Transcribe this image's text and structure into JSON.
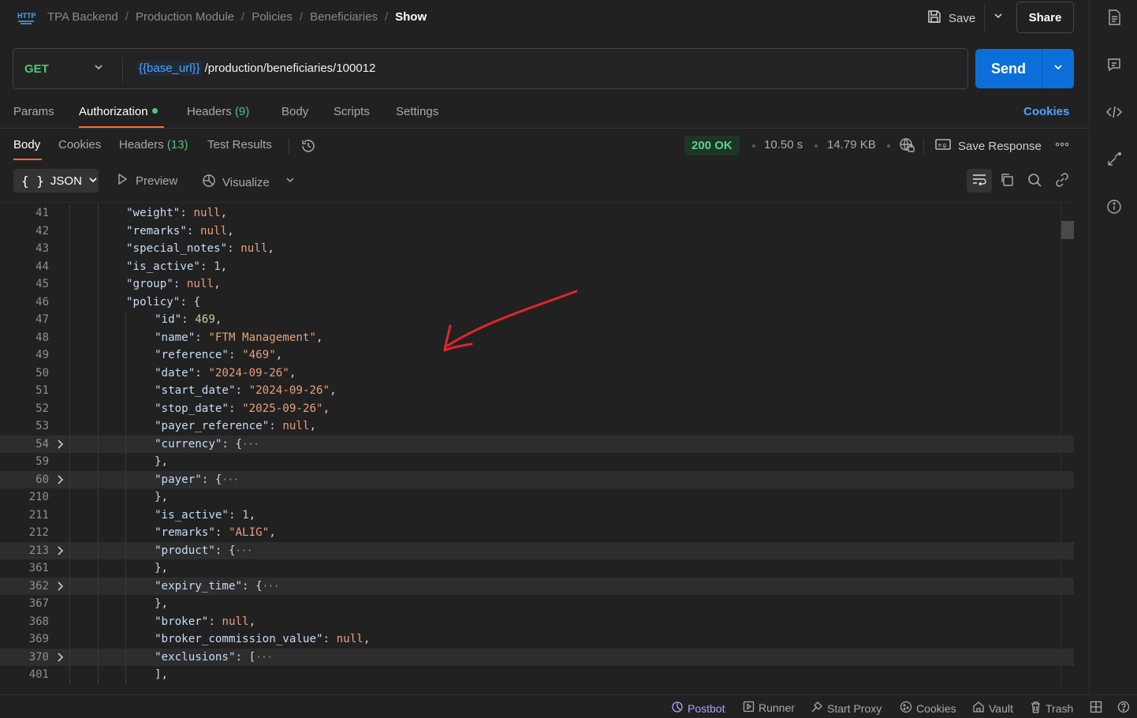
{
  "header": {
    "logo_icon": "http-icon",
    "breadcrumb": [
      "TPA Backend",
      "Production Module",
      "Policies",
      "Beneficiaries"
    ],
    "breadcrumb_current": "Show",
    "save_label": "Save",
    "share_label": "Share"
  },
  "request": {
    "method": "GET",
    "url_variable": "{{base_url}}",
    "url_path": "/production/beneficiaries/100012",
    "send_label": "Send"
  },
  "request_tabs": {
    "params": "Params",
    "authorization": "Authorization",
    "headers": "Headers",
    "headers_count": "(9)",
    "body": "Body",
    "scripts": "Scripts",
    "settings": "Settings",
    "cookies_link": "Cookies",
    "active": "Authorization"
  },
  "response_tabs": {
    "body": "Body",
    "cookies": "Cookies",
    "headers": "Headers",
    "headers_count": "(13)",
    "test_results": "Test Results",
    "active": "Body"
  },
  "response_meta": {
    "status": "200 OK",
    "time": "10.50 s",
    "size": "14.79 KB",
    "save_response": "Save Response"
  },
  "body_toolbar": {
    "format": "JSON",
    "format_icon_text": "{ }",
    "preview": "Preview",
    "visualize": "Visualize"
  },
  "code_lines": [
    {
      "ln": "41",
      "indent": 1,
      "html_key": "weight",
      "value": "null",
      "vtype": "null",
      "trail": ","
    },
    {
      "ln": "42",
      "indent": 1,
      "html_key": "remarks",
      "value": "null",
      "vtype": "null",
      "trail": ","
    },
    {
      "ln": "43",
      "indent": 1,
      "html_key": "special_notes",
      "value": "null",
      "vtype": "null",
      "trail": ","
    },
    {
      "ln": "44",
      "indent": 1,
      "html_key": "is_active",
      "value": "1",
      "vtype": "num",
      "trail": ","
    },
    {
      "ln": "45",
      "indent": 1,
      "html_key": "group",
      "value": "null",
      "vtype": "null",
      "trail": ","
    },
    {
      "ln": "46",
      "indent": 1,
      "html_key": "policy",
      "value": "{",
      "vtype": "punc",
      "trail": ""
    },
    {
      "ln": "47",
      "indent": 2,
      "html_key": "id",
      "value": "469",
      "vtype": "num",
      "trail": ","
    },
    {
      "ln": "48",
      "indent": 2,
      "html_key": "name",
      "value": "\"FTM Management\"",
      "vtype": "str",
      "trail": ","
    },
    {
      "ln": "49",
      "indent": 2,
      "html_key": "reference",
      "value": "\"469\"",
      "vtype": "str",
      "trail": ","
    },
    {
      "ln": "50",
      "indent": 2,
      "html_key": "date",
      "value": "\"2024-09-26\"",
      "vtype": "str",
      "trail": ","
    },
    {
      "ln": "51",
      "indent": 2,
      "html_key": "start_date",
      "value": "\"2024-09-26\"",
      "vtype": "str",
      "trail": ","
    },
    {
      "ln": "52",
      "indent": 2,
      "html_key": "stop_date",
      "value": "\"2025-09-26\"",
      "vtype": "str",
      "trail": ","
    },
    {
      "ln": "53",
      "indent": 2,
      "html_key": "payer_reference",
      "value": "null",
      "vtype": "null",
      "trail": ","
    },
    {
      "ln": "54",
      "indent": 2,
      "html_key": "currency",
      "value": "{",
      "vtype": "punc",
      "trail": "",
      "folded": true
    },
    {
      "ln": "59",
      "indent": 2,
      "html_key": "",
      "value": "}",
      "vtype": "punc",
      "trail": ","
    },
    {
      "ln": "60",
      "indent": 2,
      "html_key": "payer",
      "value": "{",
      "vtype": "punc",
      "trail": "",
      "folded": true
    },
    {
      "ln": "210",
      "indent": 2,
      "html_key": "",
      "value": "}",
      "vtype": "punc",
      "trail": ","
    },
    {
      "ln": "211",
      "indent": 2,
      "html_key": "is_active",
      "value": "1",
      "vtype": "num",
      "trail": ","
    },
    {
      "ln": "212",
      "indent": 2,
      "html_key": "remarks",
      "value": "\"ALIG\"",
      "vtype": "str",
      "trail": ","
    },
    {
      "ln": "213",
      "indent": 2,
      "html_key": "product",
      "value": "{",
      "vtype": "punc",
      "trail": "",
      "folded": true
    },
    {
      "ln": "361",
      "indent": 2,
      "html_key": "",
      "value": "}",
      "vtype": "punc",
      "trail": ","
    },
    {
      "ln": "362",
      "indent": 2,
      "html_key": "expiry_time",
      "value": "{",
      "vtype": "punc",
      "trail": "",
      "folded": true
    },
    {
      "ln": "367",
      "indent": 2,
      "html_key": "",
      "value": "}",
      "vtype": "punc",
      "trail": ","
    },
    {
      "ln": "368",
      "indent": 2,
      "html_key": "broker",
      "value": "null",
      "vtype": "null",
      "trail": ","
    },
    {
      "ln": "369",
      "indent": 2,
      "html_key": "broker_commission_value",
      "value": "null",
      "vtype": "null",
      "trail": ","
    },
    {
      "ln": "370",
      "indent": 2,
      "html_key": "exclusions",
      "value": "[",
      "vtype": "punc",
      "trail": "",
      "folded": true
    },
    {
      "ln": "401",
      "indent": 2,
      "html_key": "",
      "value": "]",
      "vtype": "punc",
      "trail": ","
    }
  ],
  "status_bar": {
    "postbot": "Postbot",
    "runner": "Runner",
    "start_proxy": "Start Proxy",
    "cookies": "Cookies",
    "vault": "Vault",
    "trash": "Trash"
  },
  "colors": {
    "accent_orange": "#ff6c37",
    "send_blue": "#0c6fd9",
    "method_green": "#55c27c",
    "annotation_red": "#e0262b"
  }
}
